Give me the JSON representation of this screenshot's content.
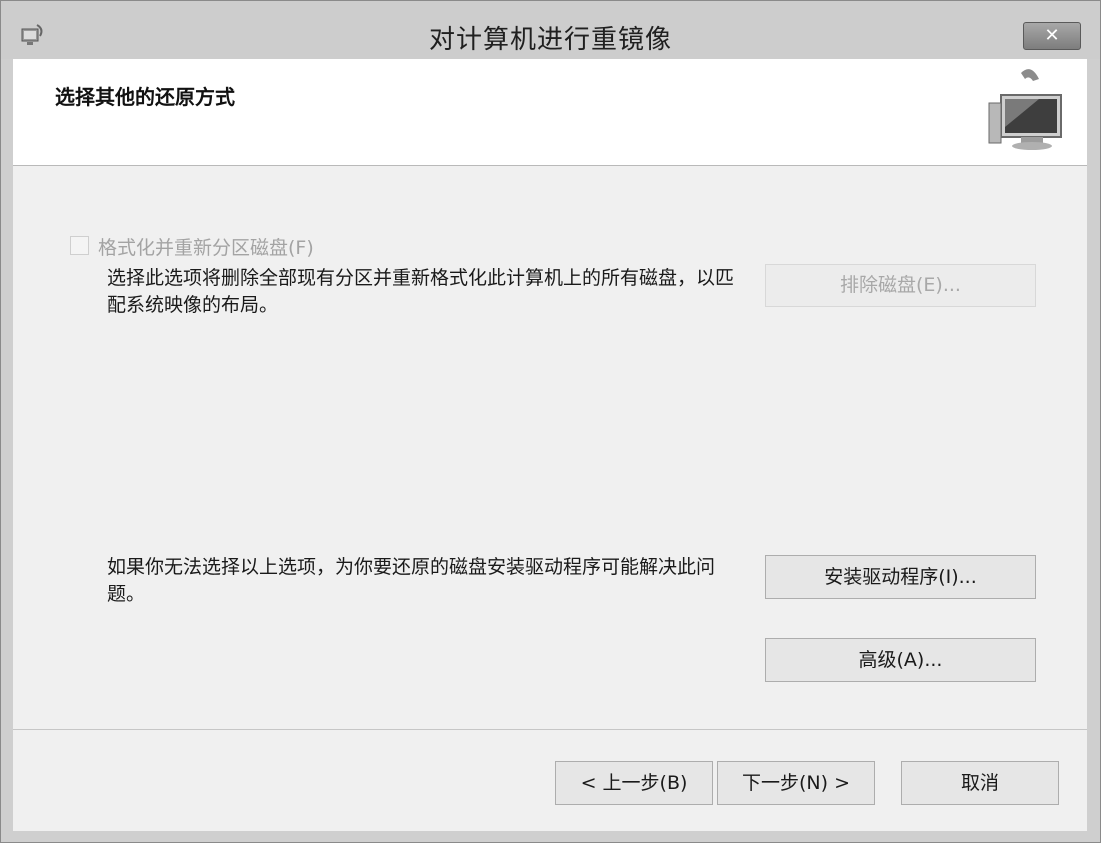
{
  "window": {
    "title": "对计算机进行重镜像",
    "close_glyph": "✕",
    "app_icon": "backup-restore-icon"
  },
  "header": {
    "title": "选择其他的还原方式",
    "icon": "computer-restore-icon"
  },
  "format_option": {
    "label": "格式化并重新分区磁盘(F)",
    "checked": false,
    "enabled": false,
    "description": "选择此选项将删除全部现有分区并重新格式化此计算机上的所有磁盘，以匹配系统映像的布局。",
    "exclude_button": "排除磁盘(E)..."
  },
  "driver_section": {
    "description": "如果你无法选择以上选项，为你要还原的磁盘安装驱动程序可能解决此问题。",
    "install_button": "安装驱动程序(I)...",
    "advanced_button": "高级(A)..."
  },
  "footer": {
    "back_button": "< 上一步(B)",
    "next_button": "下一步(N) >",
    "cancel_button": "取消"
  }
}
